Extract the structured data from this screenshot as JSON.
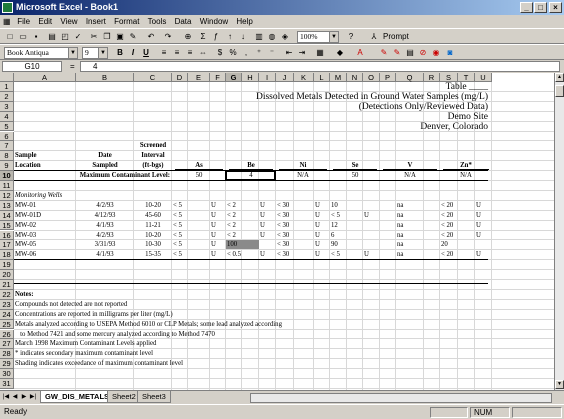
{
  "window": {
    "title": "Microsoft Excel - Book1"
  },
  "menu": [
    "File",
    "Edit",
    "View",
    "Insert",
    "Format",
    "Tools",
    "Data",
    "Window",
    "Help"
  ],
  "toolbar": {
    "zoom": "100%",
    "prompt": "Prompt",
    "font": "Book Antiqua",
    "size": "9",
    "bold": "B",
    "italic": "I",
    "underline": "U"
  },
  "formula": {
    "namebox": "G10",
    "fx": "=",
    "value": "4"
  },
  "columns": [
    "A",
    "B",
    "C",
    "D",
    "E",
    "F",
    "G",
    "H",
    "I",
    "J",
    "K",
    "L",
    "M",
    "N",
    "O",
    "P",
    "Q",
    "R",
    "S",
    "T",
    "U"
  ],
  "rows": [
    "1",
    "2",
    "3",
    "4",
    "5",
    "6",
    "7",
    "8",
    "9",
    "10",
    "11",
    "12",
    "13",
    "14",
    "15",
    "16",
    "17",
    "18",
    "19",
    "20",
    "21",
    "22",
    "23",
    "24",
    "25",
    "26",
    "27",
    "28",
    "29",
    "30",
    "31"
  ],
  "sheet": {
    "table_label": "Table ____",
    "title": "Dissolved Metals Detected in Ground Water Samples (mg/L)",
    "subtitle": "(Detections Only/Reviewed Data)",
    "site": "Demo Site",
    "location": "Denver, Colorado",
    "h_screened": "Screened",
    "h_interval": "Interval",
    "h_sample": "Sample",
    "h_date": "Date",
    "h_ftbgs": "(ft-bgs)",
    "h_location": "Location",
    "h_sampled": "Sampled",
    "analytes": [
      "As",
      "Be",
      "Ni",
      "Se",
      "V",
      "Zn*"
    ],
    "mcl_label": "Maximum Contaminant Level:",
    "mcl": [
      "50",
      "4",
      "N/A",
      "50",
      "N/A",
      "N/A"
    ],
    "section": "Monitoring Wells",
    "data_rows": [
      {
        "loc": "MW-01",
        "date": "4/2/93",
        "int": "10-20",
        "as": "< 5",
        "asq": "U",
        "be": "< 2",
        "beq": "U",
        "ni": "< 30",
        "niq": "U",
        "se": "10",
        "seq": "",
        "v": "na",
        "zn": "< 20",
        "znq": "U"
      },
      {
        "loc": "MW-01D",
        "date": "4/12/93",
        "int": "45-60",
        "as": "< 5",
        "asq": "U",
        "be": "< 2",
        "beq": "U",
        "ni": "< 30",
        "niq": "U",
        "se": "< 5",
        "seq": "U",
        "v": "na",
        "zn": "< 20",
        "znq": "U"
      },
      {
        "loc": "MW-02",
        "date": "4/1/93",
        "int": "11-21",
        "as": "< 5",
        "asq": "U",
        "be": "< 2",
        "beq": "U",
        "ni": "< 30",
        "niq": "U",
        "se": "12",
        "seq": "",
        "v": "na",
        "zn": "< 20",
        "znq": "U"
      },
      {
        "loc": "MW-03",
        "date": "4/2/93",
        "int": "10-20",
        "as": "< 5",
        "asq": "U",
        "be": "< 2",
        "beq": "U",
        "ni": "< 30",
        "niq": "U",
        "se": "6",
        "seq": "",
        "v": "na",
        "zn": "< 20",
        "znq": "U"
      },
      {
        "loc": "MW-05",
        "date": "3/31/93",
        "int": "10-30",
        "as": "< 5",
        "asq": "U",
        "be": "100",
        "beq": "",
        "ni": "< 30",
        "niq": "U",
        "se": "90",
        "seq": "",
        "v": "na",
        "zn": "20",
        "znq": ""
      },
      {
        "loc": "MW-06",
        "date": "4/1/93",
        "int": "15-35",
        "as": "< 5",
        "asq": "U",
        "be": "< 0.5",
        "beq": "U",
        "ni": "< 30",
        "niq": "U",
        "se": "< 5",
        "seq": "U",
        "v": "na",
        "zn": "< 20",
        "znq": "U"
      }
    ],
    "notes_title": "Notes:",
    "notes": [
      "Compounds not detected are not reported",
      "Concentrations are reported in milligrams per liter (mg/L)",
      "Metals analyzed according to USEPA Method 6010 or CLP Metals; some lead analyzed according",
      "   to Method 7421 and some mercury analyzed according to Method 7470",
      "March 1998 Maximum Contaminant Levels applied",
      "* indicates secondary maximum contaminant level",
      "Shading indicates exceedance of maximum contaminant level"
    ]
  },
  "tabs": [
    "GW_DIS_METALS",
    "Sheet2",
    "Sheet3"
  ],
  "status": {
    "ready": "Ready",
    "num": "NUM"
  }
}
